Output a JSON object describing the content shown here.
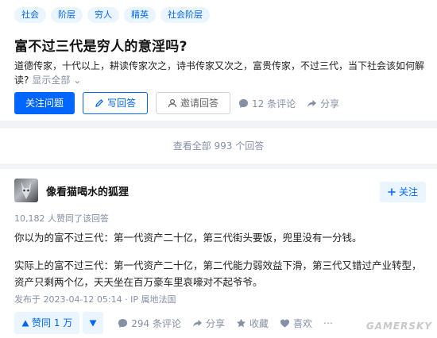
{
  "question": {
    "tags": [
      "社会",
      "阶层",
      "穷人",
      "精英",
      "社会阶层"
    ],
    "title": "富不过三代是穷人的意淫吗?",
    "description": "道德传家，十代以上，耕读传家次之，诗书传家又次之，富贵传家，不过三代，当下社会该如何解读?",
    "show_all": "显示全部",
    "actions": {
      "follow": "关注问题",
      "write": "写回答",
      "invite": "邀请回答",
      "comments": "12 条评论",
      "share": "分享"
    }
  },
  "view_all": "查看全部 993 个回答",
  "answer": {
    "author": "像看猫喝水的狐狸",
    "follow": "关注",
    "upvote_meta": "10,182 人赞同了该回答",
    "para1": "你以为的富不过三代：第一代资产二十亿，第三代街头要饭，兜里没有一分钱。",
    "para2": "实际上的富不过三代：第一代资产二十亿，第二代能力弱效益下滑，第三代又错过产业转型，资产只剩两个亿，天天坐在百万豪车里哀嚎对不起爷爷。",
    "post_meta": "发布于 2023-04-12 05:14 · IP 属地法国",
    "actions": {
      "upvote": "赞同 1 万",
      "comments": "294 条评论",
      "share": "分享",
      "collect": "收藏",
      "like": "喜欢"
    }
  },
  "watermark": "GAMERSKY"
}
